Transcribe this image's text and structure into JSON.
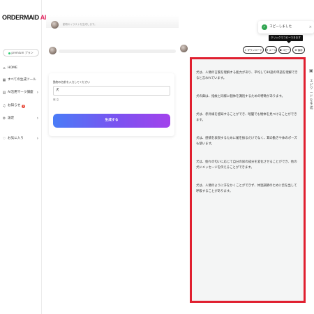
{
  "brand": {
    "logo_main": "ORDERMAID",
    "logo_ai": "AI"
  },
  "sidebar": {
    "plan_label": "premium プラン",
    "items": [
      {
        "label": "HOME",
        "icon": "home-icon",
        "glyph": "⌂"
      },
      {
        "label": "すべての生成ツール",
        "icon": "grid-icon",
        "glyph": "▦"
      },
      {
        "label": "AI活用マーク講座",
        "icon": "book-icon",
        "glyph": "▤",
        "chevron": "›"
      },
      {
        "label": "お知らせ",
        "icon": "bell-icon",
        "glyph": "♫",
        "badge": "1"
      },
      {
        "label": "設定",
        "icon": "gear-icon",
        "glyph": "⚙",
        "chevron": "›"
      },
      {
        "label": "お気に入り",
        "icon": "heart-icon",
        "glyph": "♡",
        "chevron": "›"
      }
    ]
  },
  "chat": {
    "top_text": "動物のイラストを生成します。"
  },
  "form": {
    "label": "動物の名前を入力してください",
    "input_value": "犬",
    "char_count": "残 文",
    "generate_label": "生成する"
  },
  "actions": {
    "download": "ダウンロード",
    "mail": "メール",
    "copy": "コピー",
    "save": "保存"
  },
  "toast": {
    "message": "コピーしました",
    "close": "×"
  },
  "tooltip": {
    "text": "クリックでコピーできます"
  },
  "result": {
    "paragraphs": [
      "犬は、人間の言葉を理解する能力があり、平均して80語の単語を理解できると言われています。",
      "犬の鼻は、指紋と同様に個体を識別するための特徴があります。",
      "犬は、赤外線を感知することができ、暗闇でも物体を見つけることができます。",
      "犬は、感情を表現するために尾を振るだけでなく、耳の動きや体のポーズも使います。",
      "犬は、個々の匂いに応じて自分の尿の成分を変化させることができ、他の犬にメッセージを伝えることができます。",
      "犬は、人間のように汗をかくことができず、体温調節のために舌を出して呼吸することがあります。"
    ]
  },
  "edge": {
    "text": "エピソードを生成"
  },
  "colors": {
    "accent_red": "#e02030",
    "gradient_start": "#4a7cf7",
    "gradient_end": "#a242ec",
    "success": "#2ea44f"
  }
}
